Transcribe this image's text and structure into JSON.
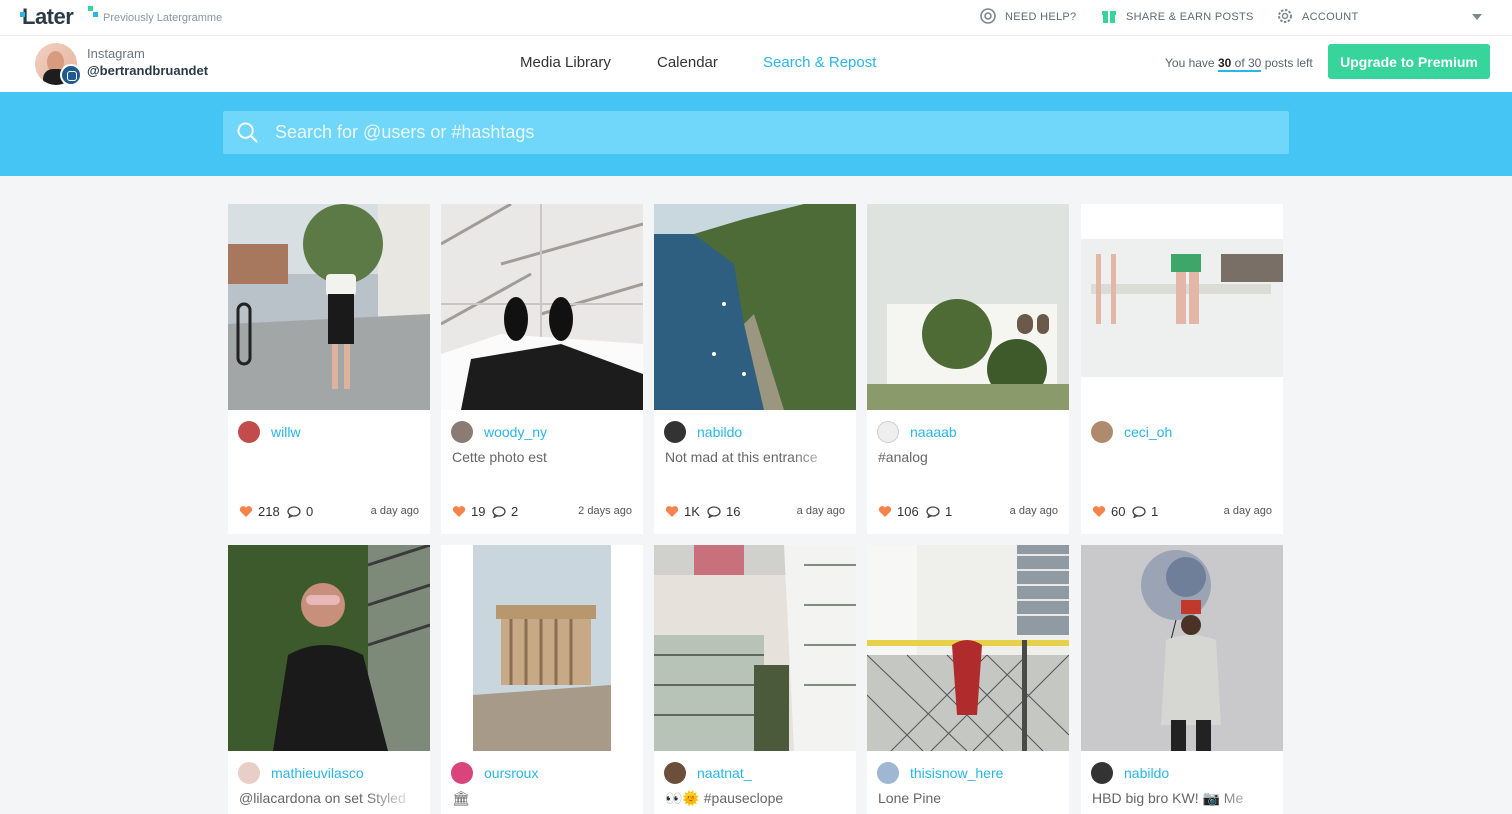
{
  "header": {
    "logo_text": "Later",
    "tagline": "Previously Latergramme",
    "links": [
      {
        "label": "NEED HELP?"
      },
      {
        "label": "SHARE & EARN POSTS"
      },
      {
        "label": "ACCOUNT"
      }
    ]
  },
  "account": {
    "type": "Instagram",
    "handle": "@bertrandbruandet"
  },
  "nav": {
    "tabs": [
      {
        "label": "Media Library",
        "active": false
      },
      {
        "label": "Calendar",
        "active": false
      },
      {
        "label": "Search & Repost",
        "active": true
      }
    ],
    "posts_prefix": "You have",
    "posts_used": "30",
    "posts_of": "of 30",
    "posts_suffix": "posts left",
    "upgrade_label": "Upgrade to Premium"
  },
  "search": {
    "placeholder": "Search for @users or #hashtags"
  },
  "colors": {
    "accent": "#29b6e8",
    "search_band": "#45c5f3",
    "upgrade": "#37d49b",
    "heart": "#f4844c"
  },
  "posts": [
    {
      "user": "willw",
      "caption": "",
      "likes": "218",
      "comments": "0",
      "ago": "a day ago"
    },
    {
      "user": "woody_ny",
      "caption": "Cette photo est",
      "likes": "19",
      "comments": "2",
      "ago": "2 days ago"
    },
    {
      "user": "nabildo",
      "caption": "Not mad at this entrance",
      "likes": "1K",
      "comments": "16",
      "ago": "a day ago"
    },
    {
      "user": "naaaab",
      "caption": "#analog",
      "likes": "106",
      "comments": "1",
      "ago": "a day ago"
    },
    {
      "user": "ceci_oh",
      "caption": "",
      "likes": "60",
      "comments": "1",
      "ago": "a day ago"
    },
    {
      "user": "mathieuvilasco",
      "caption": "@lilacardona on set Styled",
      "likes": "",
      "comments": "",
      "ago": ""
    },
    {
      "user": "oursroux",
      "caption": "🏛",
      "likes": "",
      "comments": "",
      "ago": ""
    },
    {
      "user": "naatnat_",
      "caption": "👀🌞 #pauseclope",
      "likes": "",
      "comments": "",
      "ago": ""
    },
    {
      "user": "thisisnow_here",
      "caption": "Lone Pine",
      "likes": "",
      "comments": "",
      "ago": ""
    },
    {
      "user": "nabildo",
      "caption": "HBD big bro KW! 📷 Me",
      "likes": "",
      "comments": "",
      "ago": ""
    }
  ]
}
